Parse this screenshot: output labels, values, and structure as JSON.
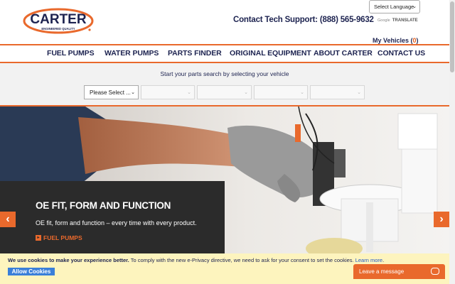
{
  "header": {
    "logo_text": "CARTER",
    "logo_tagline": "ENGINEERED QUALITY",
    "support": "Contact Tech Support: (888) 565-9632",
    "language_select": "Select Language",
    "translate_brand": "Google",
    "translate_label": "TRANSLATE",
    "my_vehicles_label": "My Vehicles (",
    "my_vehicles_count": "0",
    "my_vehicles_close": ")"
  },
  "nav": {
    "items": [
      {
        "label": "FUEL PUMPS"
      },
      {
        "label": "WATER PUMPS"
      },
      {
        "label": "PARTS FINDER"
      },
      {
        "label": "ORIGINAL EQUIPMENT"
      },
      {
        "label": "ABOUT CARTER"
      },
      {
        "label": "CONTACT US"
      }
    ]
  },
  "finder": {
    "title": "Start your parts search by selecting your vehicle",
    "first_select": "Please Select ..."
  },
  "hero": {
    "title": "OE FIT, FORM AND FUNCTION",
    "text": "OE fit, form and function – every time with every product.",
    "link": "FUEL PUMPS",
    "prev_label": "‹",
    "next_label": "›"
  },
  "cookie": {
    "bold": "We use cookies to make your experience better.",
    "text": " To comply with the new e-Privacy directive, we need to ask for your consent to set the cookies. ",
    "more": "Learn more",
    "end": ".",
    "allow": "Allow Cookies"
  },
  "chat": {
    "label": "Leave a message"
  },
  "colors": {
    "accent": "#e9692c",
    "navy": "#1d2350",
    "cookie_bg": "#fdf4be",
    "allow_button": "#3a7fd9"
  }
}
